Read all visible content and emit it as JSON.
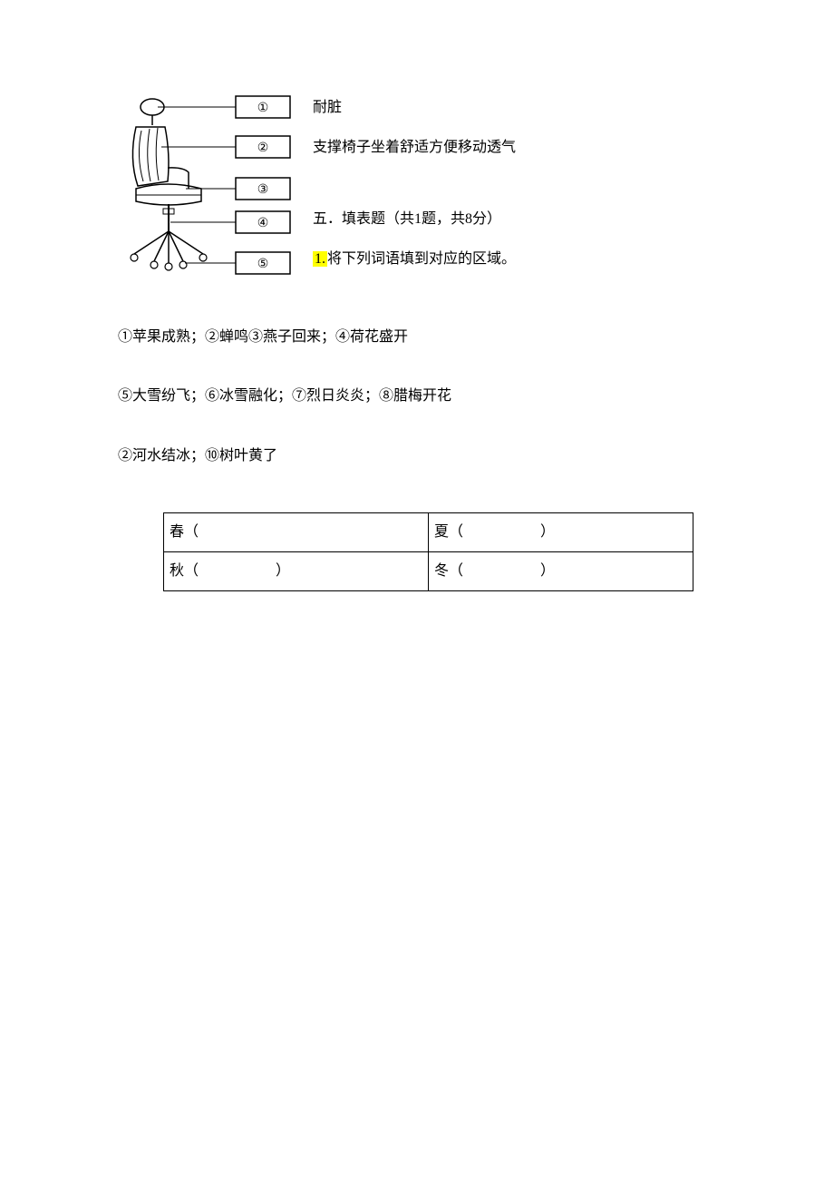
{
  "diagram": {
    "labels": [
      "①",
      "②",
      "③",
      "④",
      "⑤"
    ]
  },
  "rightCol": {
    "line1": "耐脏",
    "line2": "支撑椅子坐着舒适方便移动透气",
    "section": "五．填表题（共1题，共8分）",
    "qnum": "1.",
    "qtext": "将下列词语填到对应的区域。"
  },
  "items": {
    "line1": "①苹果成熟；②蝉鸣③燕子回来；④荷花盛开",
    "line2": "⑤大雪纷飞；⑥冰雪融化；⑦烈日炎炎；⑧腊梅开花",
    "line3": "②河水结冰；⑩树叶黄了"
  },
  "table": {
    "r1c1": "春（",
    "r1c2_label": "夏",
    "r2c1_label": "秋",
    "r2c2_label": "冬",
    "open": "（",
    "close": "）"
  }
}
